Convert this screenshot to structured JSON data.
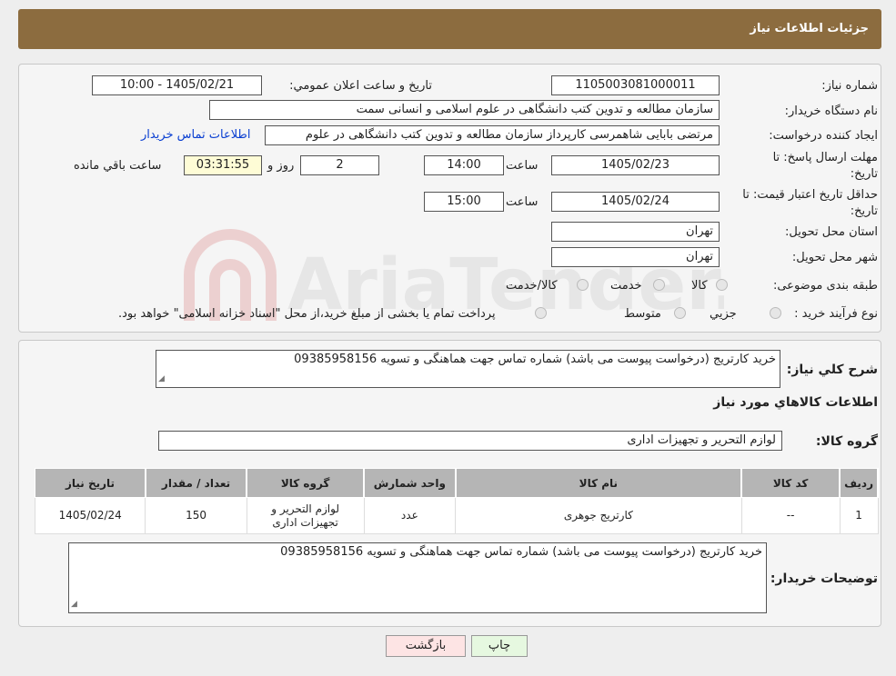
{
  "header": {
    "title": "جزئیات اطلاعات نیاز"
  },
  "watermark_text": "AriaTender.neT",
  "form": {
    "need_number": {
      "label": "شماره نیاز:",
      "value": "1105003081000011"
    },
    "announce": {
      "label": "تاریخ و ساعت اعلان عمومي:",
      "value": "1405/02/21 - 10:00"
    },
    "buyer_org": {
      "label": "نام دستگاه خريدار:",
      "value": "سازمان مطالعه و تدوین کتب دانشگاهی در علوم اسلامی و انسانی سمت"
    },
    "creator": {
      "label": "ايجاد کننده درخواست:",
      "value": "مرتضی بابایی شاهمرسی کارپرداز سازمان مطالعه و تدوین کتب دانشگاهی در علوم",
      "contact_link": "اطلاعات تماس خريدار"
    },
    "deadline": {
      "label_line1": "مهلت ارسال پاسخ: تا",
      "label_line2": "تاريخ:",
      "date": "1405/02/23",
      "time_label": "ساعت",
      "time": "14:00",
      "days": "2",
      "days_label": "روز و",
      "remaining": "03:31:55",
      "remaining_label": "ساعت باقي مانده"
    },
    "validity": {
      "label_line1": "حداقل تاريخ اعتبار قيمت: تا",
      "label_line2": "تاريخ:",
      "date": "1405/02/24",
      "time_label": "ساعت",
      "time": "15:00"
    },
    "province": {
      "label": "استان محل تحويل:",
      "value": "تهران"
    },
    "city": {
      "label": "شهر محل تحويل:",
      "value": "تهران"
    },
    "category": {
      "label": "طبقه بندی موضوعی:",
      "options": [
        "کالا",
        "خدمت",
        "کالا/خدمت"
      ]
    },
    "purchase_type": {
      "label": "نوع فرآيند خريد :",
      "options": [
        "جزيي",
        "متوسط"
      ],
      "note": "پرداخت تمام يا بخشی از مبلغ خريد،از محل \"اسناد خزانه اسلامی\" خواهد بود."
    }
  },
  "summary": {
    "label": "شرح كلي نياز:",
    "value": "خرید کارتریج (درخواست پیوست می باشد) شماره تماس جهت هماهنگی و تسویه 09385958156",
    "items_title": "اطلاعات كالاهاي مورد نياز",
    "group_label": "گروه کالا:",
    "group_value": "لوازم التحرير و تجهيزات اداری"
  },
  "table": {
    "headers": [
      "رديف",
      "کد کالا",
      "نام کالا",
      "واحد شمارش",
      "گروه کالا",
      "تعداد / مقدار",
      "تاريخ نياز"
    ],
    "rows": [
      [
        "1",
        "--",
        "کارتریج جوهری",
        "عدد",
        "لوازم التحرير و تجهيزات اداری",
        "150",
        "1405/02/24"
      ]
    ]
  },
  "buyer_notes": {
    "label": "توضيحات خريدار:",
    "value": "خرید کارتریج (درخواست پیوست می باشد) شماره تماس جهت هماهنگی و تسویه 09385958156"
  },
  "buttons": {
    "print": "چاپ",
    "back": "بازگشت"
  },
  "colors": {
    "header": "#8c6c3f",
    "table_header": "#b5b5b5",
    "print_btn": "#e6f8e0",
    "back_btn": "#fde4e4",
    "remaining_bg": "#fefcd6",
    "link": "#0a3fd1"
  }
}
